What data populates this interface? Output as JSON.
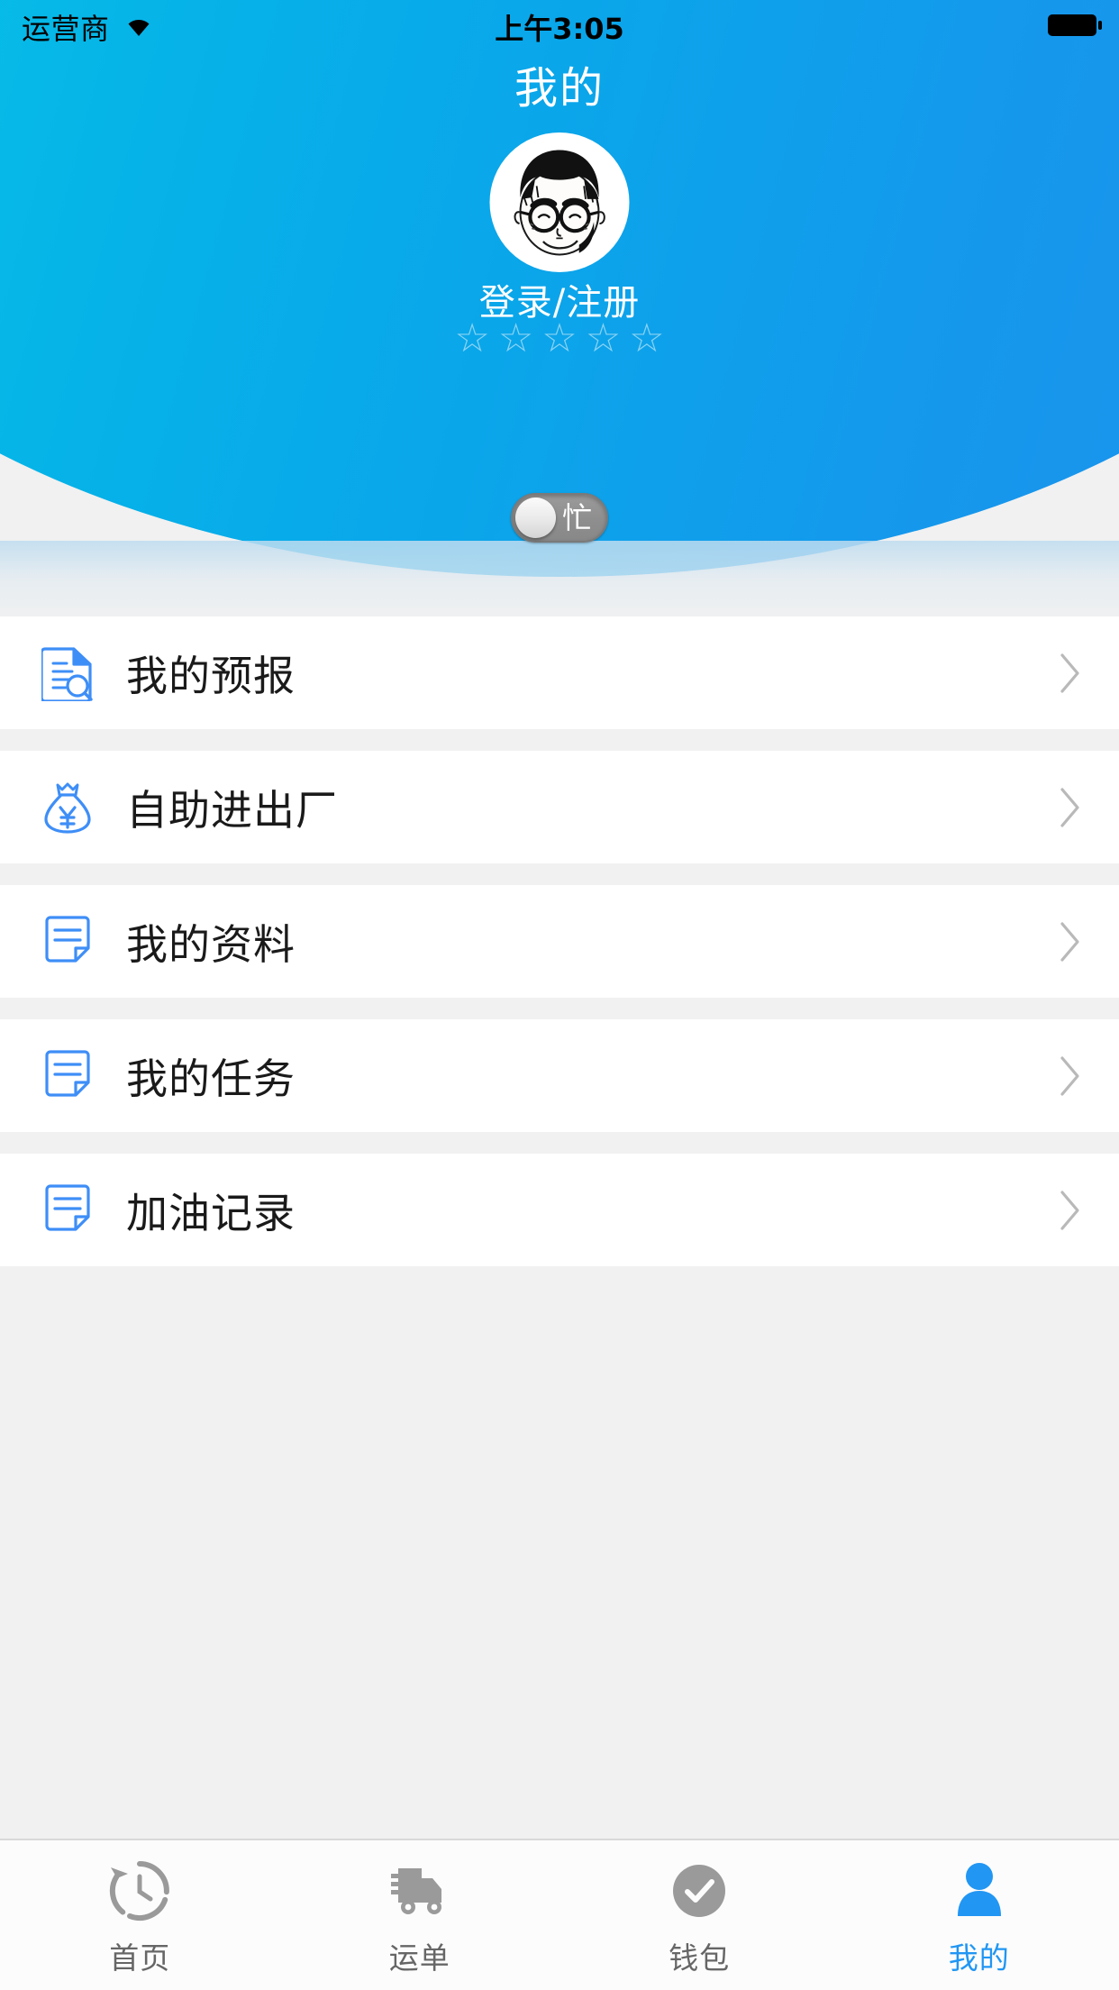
{
  "statusbar": {
    "carrier": "运营商",
    "wifi_icon": "wifi-icon",
    "time": "上午3:05",
    "battery_icon": "battery-full-icon"
  },
  "header": {
    "title": "我的",
    "avatar_icon": "avatar-cartoon-face",
    "login_label": "登录/注册",
    "rating": {
      "max": 5,
      "filled": 0,
      "star_icon": "star-outline-icon",
      "star_color": "#8ad3f2"
    },
    "busy_toggle": {
      "label": "忙",
      "state": "off",
      "knob_position": "left"
    },
    "gradient_from": "#09cdea",
    "gradient_to": "#1e8fed"
  },
  "menu": {
    "icon_color": "#3e8ef7",
    "chevron_icon": "chevron-right-icon",
    "items": [
      {
        "label": "我的预报",
        "icon": "document-search-icon"
      },
      {
        "label": "自助进出厂",
        "icon": "money-bag-yuan-icon"
      },
      {
        "label": "我的资料",
        "icon": "note-folded-icon"
      },
      {
        "label": "我的任务",
        "icon": "note-folded-icon"
      },
      {
        "label": "加油记录",
        "icon": "note-folded-icon"
      }
    ]
  },
  "tabbar": {
    "active_color": "#2196f3",
    "inactive_color": "#999999",
    "tabs": [
      {
        "label": "首页",
        "icon": "clock-history-icon",
        "active": false
      },
      {
        "label": "运单",
        "icon": "truck-icon",
        "active": false
      },
      {
        "label": "钱包",
        "icon": "check-circle-icon",
        "active": false
      },
      {
        "label": "我的",
        "icon": "person-icon",
        "active": true
      }
    ]
  }
}
